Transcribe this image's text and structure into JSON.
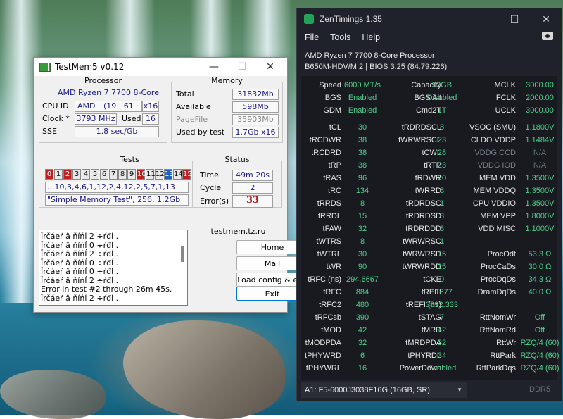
{
  "testmem": {
    "title": "TestMem5 v0.12",
    "processor": {
      "group": "Processor",
      "name": "AMD Ryzen 7 7700 8-Core",
      "cpuid_label": "CPU ID",
      "cpuid_vendor": "AMD",
      "cpuid_value": "(19 · 61 · 2)",
      "cpuid_threads": "x16",
      "clock_label": "Clock *",
      "clock_value": "3793 MHz",
      "used_label": "Used",
      "used_value": "16",
      "sse_label": "SSE",
      "sse_value": "1.8 sec/Gb"
    },
    "memory": {
      "group": "Memory",
      "total_label": "Total",
      "total_value": "31832Mb",
      "available_label": "Available",
      "available_value": "598Mb",
      "pagefile_label": "PageFile",
      "pagefile_value": "35903Mb",
      "usedby_label": "Used by test",
      "usedby_value": "1.7Gb x16"
    },
    "tests": {
      "group": "Tests",
      "cells": [
        {
          "n": "0",
          "c": "red"
        },
        {
          "n": "1",
          "c": ""
        },
        {
          "n": "2",
          "c": "red"
        },
        {
          "n": "3",
          "c": ""
        },
        {
          "n": "4",
          "c": ""
        },
        {
          "n": "5",
          "c": ""
        },
        {
          "n": "6",
          "c": ""
        },
        {
          "n": "7",
          "c": ""
        },
        {
          "n": "8",
          "c": ""
        },
        {
          "n": "9",
          "c": ""
        },
        {
          "n": "10",
          "c": "red"
        },
        {
          "n": "11",
          "c": ""
        },
        {
          "n": "12",
          "c": ""
        },
        {
          "n": "13",
          "c": "blue"
        },
        {
          "n": "14",
          "c": ""
        },
        {
          "n": "15",
          "c": "red"
        }
      ],
      "sequence": "...10,3,4,6,1,12,2,4,12,2,5,7,1,13",
      "config": "\"Simple Memory Test\", 256, 1.2Gb"
    },
    "status": {
      "group": "Status",
      "time_label": "Time",
      "time_value": "49m 20s",
      "cycle_label": "Cycle",
      "cycle_value": "2",
      "errors_label": "Error(s)",
      "errors_value": "33"
    },
    "log": [
      "Îrčáeŕ â ňíńĺ 2 ÷ŕđĺ .",
      "Îrčáeŕ â ňíńĺ 0 ÷ŕđĺ .",
      "Îrčáeŕ â ňíńĺ 2 ÷ŕđĺ .",
      "Îrčáeŕ â ňíńĺ 0 ÷ŕđĺ .",
      "Îrčáeŕ â ňíńĺ 0 ÷ŕđĺ .",
      "Îrčáeŕ â ňíńĺ 2 ÷ŕđĺ .",
      "Error in test #2 through 26m 45s.",
      "Îrčáeŕ â ňíńĺ 2 ÷ŕđĺ ."
    ],
    "site": "testmem.tz.ru",
    "buttons": {
      "home": "Home",
      "mail": "Mail",
      "load": "Load config & exit",
      "exit": "Exit"
    }
  },
  "zen": {
    "title": "ZenTimings 1.35",
    "menu": {
      "file": "File",
      "tools": "Tools",
      "help": "Help"
    },
    "cpu": "AMD Ryzen 7 7700 8-Core Processor",
    "board": "B650M-HDV/M.2 | BIOS 3.25 (84.79.226)",
    "top_rows": [
      [
        "Speed",
        "6000 MT/s",
        "Capacity",
        "32GB",
        "MCLK",
        "3000.00"
      ],
      [
        "BGS",
        "Enabled",
        "BGS Alt",
        "Disabled",
        "FCLK",
        "2000.00"
      ],
      [
        "GDM",
        "Enabled",
        "Cmd2T",
        "1T",
        "UCLK",
        "3000.00"
      ]
    ],
    "rows": [
      [
        "tCL",
        "30",
        "tRDRDSCL",
        "8",
        "VSOC (SMU)",
        "1.1800V"
      ],
      [
        "tRCDWR",
        "38",
        "tWRWRSCL",
        "23",
        "CLDO VDDP",
        "1.1484V"
      ],
      [
        "tRCDRD",
        "38",
        "tCWL",
        "28",
        "VDDG CCD",
        "N/A"
      ],
      [
        "tRP",
        "38",
        "tRTP",
        "23",
        "VDDG IOD",
        "N/A"
      ],
      [
        "tRAS",
        "96",
        "tRDWR",
        "20",
        "MEM VDD",
        "1.3500V"
      ],
      [
        "tRC",
        "134",
        "tWRRD",
        "8",
        "MEM VDDQ",
        "1.3500V"
      ],
      [
        "tRRDS",
        "8",
        "tRDRDSC",
        "1",
        "CPU VDDIO",
        "1.3500V"
      ],
      [
        "tRRDL",
        "15",
        "tRDRDSD",
        "8",
        "MEM VPP",
        "1.8000V"
      ],
      [
        "tFAW",
        "32",
        "tRDRDDD",
        "8",
        "VDD MISC",
        "1.1000V"
      ],
      [
        "tWTRS",
        "8",
        "tWRWRSC",
        "1",
        "",
        ""
      ],
      [
        "tWTRL",
        "30",
        "tWRWRSD",
        "15",
        "ProcOdt",
        "53.3 Ω"
      ],
      [
        "tWR",
        "90",
        "tWRWRDD",
        "15",
        "ProcCaDs",
        "30.0 Ω"
      ],
      [
        "tRFC (ns)",
        "294.6667",
        "tCKE",
        "0",
        "ProcDqDs",
        "34.3 Ω"
      ],
      [
        "tRFC",
        "884",
        "tREFI",
        "11677",
        "DramDqDs",
        "40.0 Ω"
      ],
      [
        "tRFC2",
        "480",
        "tREFI (ns)",
        "3892.333",
        "",
        ""
      ],
      [
        "tRFCsb",
        "390",
        "tSTAG",
        "7",
        "RttNomWr",
        "Off"
      ],
      [
        "tMOD",
        "42",
        "tMRD",
        "42",
        "RttNomRd",
        "Off"
      ],
      [
        "tMODPDA",
        "32",
        "tMRDPDA",
        "32",
        "RttWr",
        "RZQ/4 (60)"
      ],
      [
        "tPHYWRD",
        "6",
        "tPHYRDL",
        "34",
        "RttPark",
        "RZQ/4 (60)"
      ],
      [
        "tPHYWRL",
        "16",
        "PowerDown",
        "Enabled",
        "RttParkDqs",
        "RZQ/4 (60)"
      ]
    ],
    "module": "A1: F5-6000J3038F16G (16GB, SR)",
    "ddr": "DDR5"
  }
}
